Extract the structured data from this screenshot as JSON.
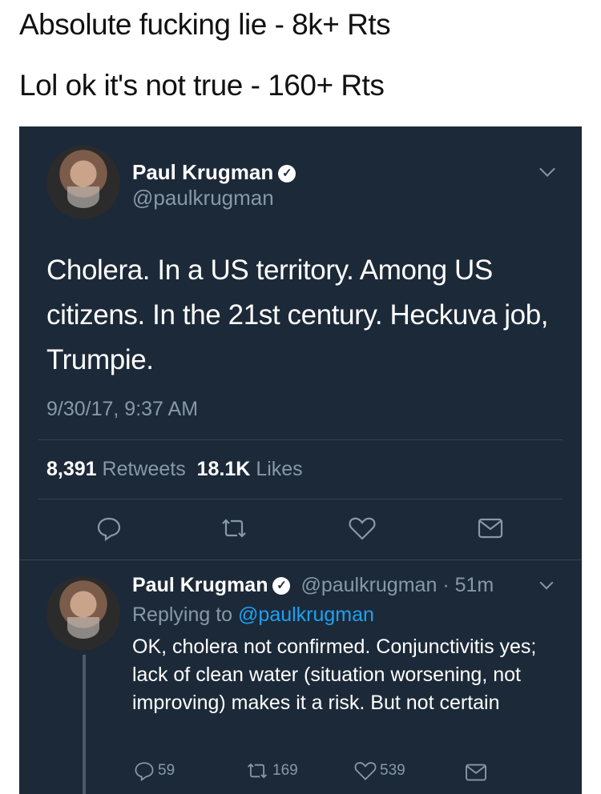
{
  "captions": {
    "line1": "Absolute fucking lie - 8k+ Rts",
    "line2": "Lol ok it's not true - 160+ Rts"
  },
  "main_tweet": {
    "name": "Paul Krugman",
    "handle": "@paulkrugman",
    "text": "Cholera. In a US territory. Among US citizens. In the 21st century. Heckuva job, Trumpie.",
    "timestamp": "9/30/17, 9:37 AM",
    "retweets_count": "8,391",
    "retweets_label": "Retweets",
    "likes_count": "18.1K",
    "likes_label": "Likes"
  },
  "reply_tweet": {
    "name": "Paul Krugman",
    "handle": "@paulkrugman",
    "time": "· 51m",
    "replying_prefix": "Replying to",
    "replying_handle": "@paulkrugman",
    "text": "OK, cholera not confirmed. Conjunctivitis yes; lack of clean water (situation worsening, not improving) makes it a risk. But  not certain",
    "reply_count": "59",
    "retweet_count": "169",
    "like_count": "539"
  },
  "colors": {
    "card_bg": "#1c2938",
    "muted": "#8899a6",
    "link": "#1da1f2",
    "divider": "#38444d"
  },
  "icons": [
    "verified-badge-icon",
    "chevron-down-icon",
    "reply-icon",
    "retweet-icon",
    "like-icon",
    "share-mail-icon"
  ]
}
